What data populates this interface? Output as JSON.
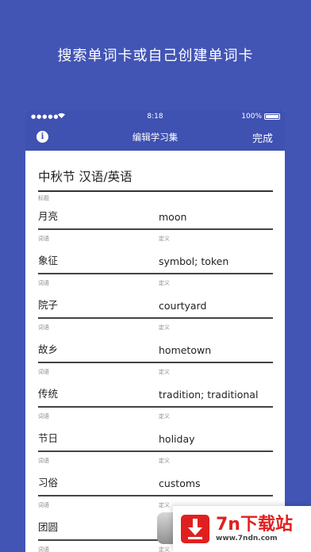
{
  "headline": "搜索单词卡或自己创建单词卡",
  "status_bar": {
    "time": "8:18",
    "battery": "100%",
    "signal_icon": "signal-dots-icon",
    "wifi_icon": "wifi-icon"
  },
  "nav": {
    "title": "编辑学习集",
    "done_label": "完成",
    "info_icon": "info-icon"
  },
  "set": {
    "title": "中秋节 汉语/英语",
    "title_caption": "标题"
  },
  "labels": {
    "term": "词语",
    "definition": "定义"
  },
  "cards": [
    {
      "term": "月亮",
      "definition": "moon"
    },
    {
      "term": "象征",
      "definition": "symbol; token"
    },
    {
      "term": "院子",
      "definition": "courtyard"
    },
    {
      "term": "故乡",
      "definition": "hometown"
    },
    {
      "term": "传统",
      "definition": "tradition; traditional"
    },
    {
      "term": "节日",
      "definition": "holiday"
    },
    {
      "term": "习俗",
      "definition": "customs"
    },
    {
      "term": "团圆",
      "definition": ""
    }
  ],
  "watermark": {
    "main": "7n下载站",
    "url": "www.7ndn.com",
    "brand_color": "#e02020"
  },
  "colors": {
    "background": "#4255b5",
    "bar": "#3f51b1"
  }
}
